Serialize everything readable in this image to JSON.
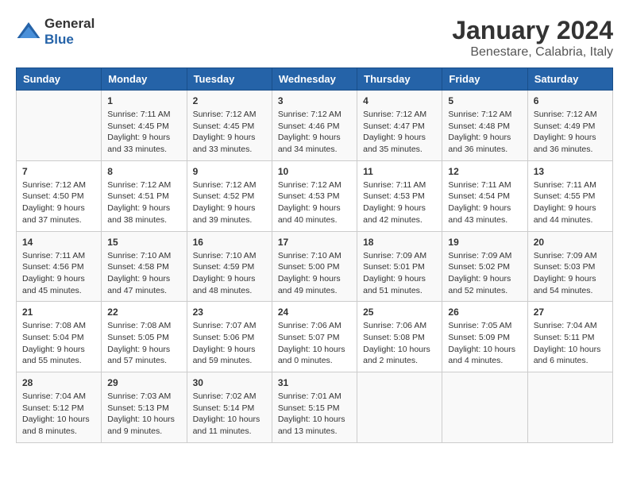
{
  "logo": {
    "line1": "General",
    "line2": "Blue"
  },
  "title": "January 2024",
  "subtitle": "Benestare, Calabria, Italy",
  "days_of_week": [
    "Sunday",
    "Monday",
    "Tuesday",
    "Wednesday",
    "Thursday",
    "Friday",
    "Saturday"
  ],
  "weeks": [
    [
      {
        "day": "",
        "info": ""
      },
      {
        "day": "1",
        "info": "Sunrise: 7:11 AM\nSunset: 4:45 PM\nDaylight: 9 hours\nand 33 minutes."
      },
      {
        "day": "2",
        "info": "Sunrise: 7:12 AM\nSunset: 4:45 PM\nDaylight: 9 hours\nand 33 minutes."
      },
      {
        "day": "3",
        "info": "Sunrise: 7:12 AM\nSunset: 4:46 PM\nDaylight: 9 hours\nand 34 minutes."
      },
      {
        "day": "4",
        "info": "Sunrise: 7:12 AM\nSunset: 4:47 PM\nDaylight: 9 hours\nand 35 minutes."
      },
      {
        "day": "5",
        "info": "Sunrise: 7:12 AM\nSunset: 4:48 PM\nDaylight: 9 hours\nand 36 minutes."
      },
      {
        "day": "6",
        "info": "Sunrise: 7:12 AM\nSunset: 4:49 PM\nDaylight: 9 hours\nand 36 minutes."
      }
    ],
    [
      {
        "day": "7",
        "info": "Sunrise: 7:12 AM\nSunset: 4:50 PM\nDaylight: 9 hours\nand 37 minutes."
      },
      {
        "day": "8",
        "info": "Sunrise: 7:12 AM\nSunset: 4:51 PM\nDaylight: 9 hours\nand 38 minutes."
      },
      {
        "day": "9",
        "info": "Sunrise: 7:12 AM\nSunset: 4:52 PM\nDaylight: 9 hours\nand 39 minutes."
      },
      {
        "day": "10",
        "info": "Sunrise: 7:12 AM\nSunset: 4:53 PM\nDaylight: 9 hours\nand 40 minutes."
      },
      {
        "day": "11",
        "info": "Sunrise: 7:11 AM\nSunset: 4:53 PM\nDaylight: 9 hours\nand 42 minutes."
      },
      {
        "day": "12",
        "info": "Sunrise: 7:11 AM\nSunset: 4:54 PM\nDaylight: 9 hours\nand 43 minutes."
      },
      {
        "day": "13",
        "info": "Sunrise: 7:11 AM\nSunset: 4:55 PM\nDaylight: 9 hours\nand 44 minutes."
      }
    ],
    [
      {
        "day": "14",
        "info": "Sunrise: 7:11 AM\nSunset: 4:56 PM\nDaylight: 9 hours\nand 45 minutes."
      },
      {
        "day": "15",
        "info": "Sunrise: 7:10 AM\nSunset: 4:58 PM\nDaylight: 9 hours\nand 47 minutes."
      },
      {
        "day": "16",
        "info": "Sunrise: 7:10 AM\nSunset: 4:59 PM\nDaylight: 9 hours\nand 48 minutes."
      },
      {
        "day": "17",
        "info": "Sunrise: 7:10 AM\nSunset: 5:00 PM\nDaylight: 9 hours\nand 49 minutes."
      },
      {
        "day": "18",
        "info": "Sunrise: 7:09 AM\nSunset: 5:01 PM\nDaylight: 9 hours\nand 51 minutes."
      },
      {
        "day": "19",
        "info": "Sunrise: 7:09 AM\nSunset: 5:02 PM\nDaylight: 9 hours\nand 52 minutes."
      },
      {
        "day": "20",
        "info": "Sunrise: 7:09 AM\nSunset: 5:03 PM\nDaylight: 9 hours\nand 54 minutes."
      }
    ],
    [
      {
        "day": "21",
        "info": "Sunrise: 7:08 AM\nSunset: 5:04 PM\nDaylight: 9 hours\nand 55 minutes."
      },
      {
        "day": "22",
        "info": "Sunrise: 7:08 AM\nSunset: 5:05 PM\nDaylight: 9 hours\nand 57 minutes."
      },
      {
        "day": "23",
        "info": "Sunrise: 7:07 AM\nSunset: 5:06 PM\nDaylight: 9 hours\nand 59 minutes."
      },
      {
        "day": "24",
        "info": "Sunrise: 7:06 AM\nSunset: 5:07 PM\nDaylight: 10 hours\nand 0 minutes."
      },
      {
        "day": "25",
        "info": "Sunrise: 7:06 AM\nSunset: 5:08 PM\nDaylight: 10 hours\nand 2 minutes."
      },
      {
        "day": "26",
        "info": "Sunrise: 7:05 AM\nSunset: 5:09 PM\nDaylight: 10 hours\nand 4 minutes."
      },
      {
        "day": "27",
        "info": "Sunrise: 7:04 AM\nSunset: 5:11 PM\nDaylight: 10 hours\nand 6 minutes."
      }
    ],
    [
      {
        "day": "28",
        "info": "Sunrise: 7:04 AM\nSunset: 5:12 PM\nDaylight: 10 hours\nand 8 minutes."
      },
      {
        "day": "29",
        "info": "Sunrise: 7:03 AM\nSunset: 5:13 PM\nDaylight: 10 hours\nand 9 minutes."
      },
      {
        "day": "30",
        "info": "Sunrise: 7:02 AM\nSunset: 5:14 PM\nDaylight: 10 hours\nand 11 minutes."
      },
      {
        "day": "31",
        "info": "Sunrise: 7:01 AM\nSunset: 5:15 PM\nDaylight: 10 hours\nand 13 minutes."
      },
      {
        "day": "",
        "info": ""
      },
      {
        "day": "",
        "info": ""
      },
      {
        "day": "",
        "info": ""
      }
    ]
  ]
}
